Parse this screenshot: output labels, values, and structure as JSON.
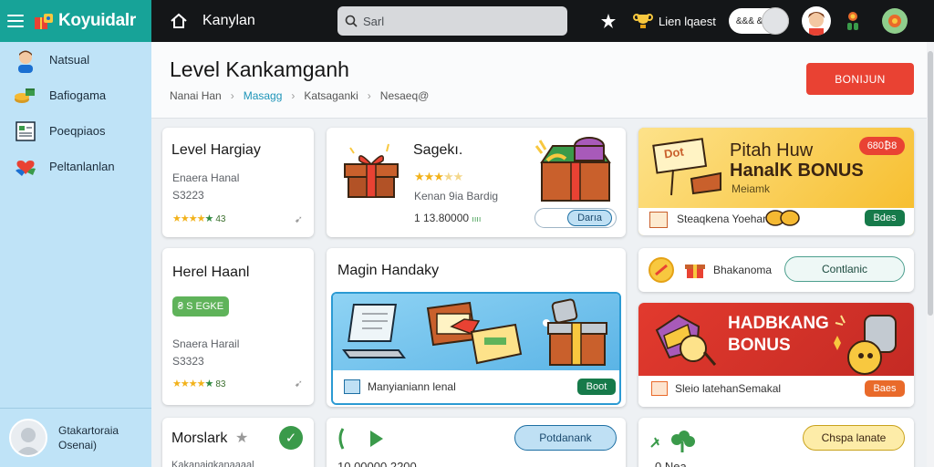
{
  "app": {
    "title": "Koyuidalr"
  },
  "sidebar": {
    "items": [
      {
        "label": "Natsual",
        "icon": "user-avatar-icon"
      },
      {
        "label": "Bafiogama",
        "icon": "coins-icon"
      },
      {
        "label": "Poeqpiaos",
        "icon": "clipboard-icon"
      },
      {
        "label": "Peltanlanlan",
        "icon": "heart-hands-icon"
      }
    ],
    "footer": {
      "line1": "Gtakartoraia",
      "line2": "Osenai)"
    }
  },
  "topbar": {
    "title": "Kanylan",
    "search_placeholder": "Sarl",
    "level_text": "Lien lqaest",
    "toggle_text": "&&& &&"
  },
  "header": {
    "title": "Level Kankamganh",
    "breadcrumbs": [
      "Nanai Han",
      "Masagg",
      "Katsaganki",
      "Nesaeq@"
    ],
    "active_crumb_index": 1,
    "button_label": "BONIJUN"
  },
  "cards": {
    "c1": {
      "title": "Level Hargiay",
      "line1": "Enaera Hanal",
      "line2": "S3223",
      "rating": "43"
    },
    "c2": {
      "title": "Sagekı.",
      "desc": "Kenan 9ia Bardig",
      "price": "1 13.80000",
      "price_suffix": "ıııı",
      "button": "Darıa"
    },
    "c3": {
      "title": "Pitah Huw",
      "subtitle": "HanalK BONUS",
      "sub2": "Meiamk",
      "footer": "Steaqkena Yoehan",
      "button": "Bdes",
      "sign": "Dot"
    },
    "c4": {
      "title": "Herel Haanl",
      "badge": "₴ S EGKE",
      "line1": "Snaera Harail",
      "line2": "S3323",
      "rating": "83"
    },
    "c5": {
      "title": "Magin Handaky",
      "footer": "Manyianiann lenal",
      "button": "Boot"
    },
    "c6": {
      "label": "Bhakanoma",
      "button": "Contlanic"
    },
    "c7": {
      "title": "HADBKANG",
      "subtitle": "BONUS",
      "footer": "Sleio latehanSemakal",
      "button": "Baes"
    },
    "c8": {
      "title": "Morslark",
      "line1": "Kakanaiqkanaaaal"
    },
    "c9": {
      "button": "Potdanank",
      "line1": "10 00000 2200"
    },
    "c10": {
      "button": "Chspa lanate",
      "line1": "0 Nea"
    }
  },
  "colors": {
    "teal": "#17a398",
    "sidebar": "#bfe3f7",
    "topbar": "#141618",
    "red": "#e94233",
    "green_btn": "#167a4a",
    "yellow": "#f8c83f"
  }
}
